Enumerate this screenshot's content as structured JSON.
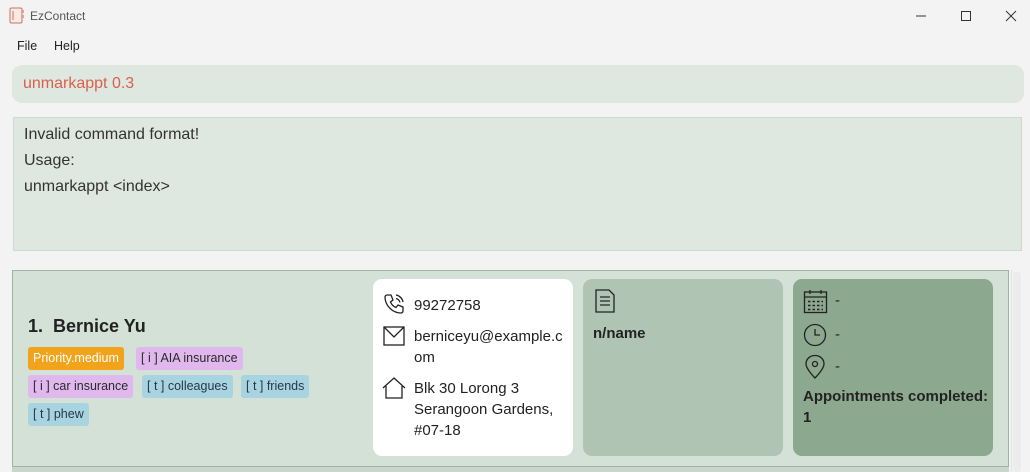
{
  "window": {
    "title": "EzContact"
  },
  "menu": {
    "file": "File",
    "help": "Help"
  },
  "command_box": {
    "value": "unmarkappt 0.3"
  },
  "result_display": {
    "lines": [
      "Invalid command format!",
      "Usage:",
      "unmarkappt <index>"
    ]
  },
  "person_list": [
    {
      "index_name": "1.  Bernice Yu",
      "tags": {
        "priority": "Priority.medium",
        "insurance_1": "[ i ] AIA insurance",
        "insurance_2": "[ i ] car insurance",
        "tag_1": "[ t ] colleagues",
        "tag_2": "[ t ] friends",
        "tag_3": "[ t ] phew"
      },
      "phone": "99272758",
      "email_line_1": "berniceyu@example.c",
      "email_line_2": "om",
      "address_line_1": "Blk 30 Lorong 3",
      "address_line_2": "Serangoon Gardens,",
      "address_line_3": "#07-18",
      "note": "n/name",
      "appointment_date": "-",
      "appointment_time": "-",
      "appointment_venue": "-",
      "appointments_completed_label": "Appointments completed:",
      "appointments_completed_count": "1"
    }
  ],
  "colors": {
    "command_text": "#d9614a",
    "priority_tag": "#f2a31c",
    "insurance_tag": "#e0b8ed",
    "tag": "#a8d4e2",
    "note_card": "#afc4b2",
    "appointment_card": "#8ca88f"
  }
}
